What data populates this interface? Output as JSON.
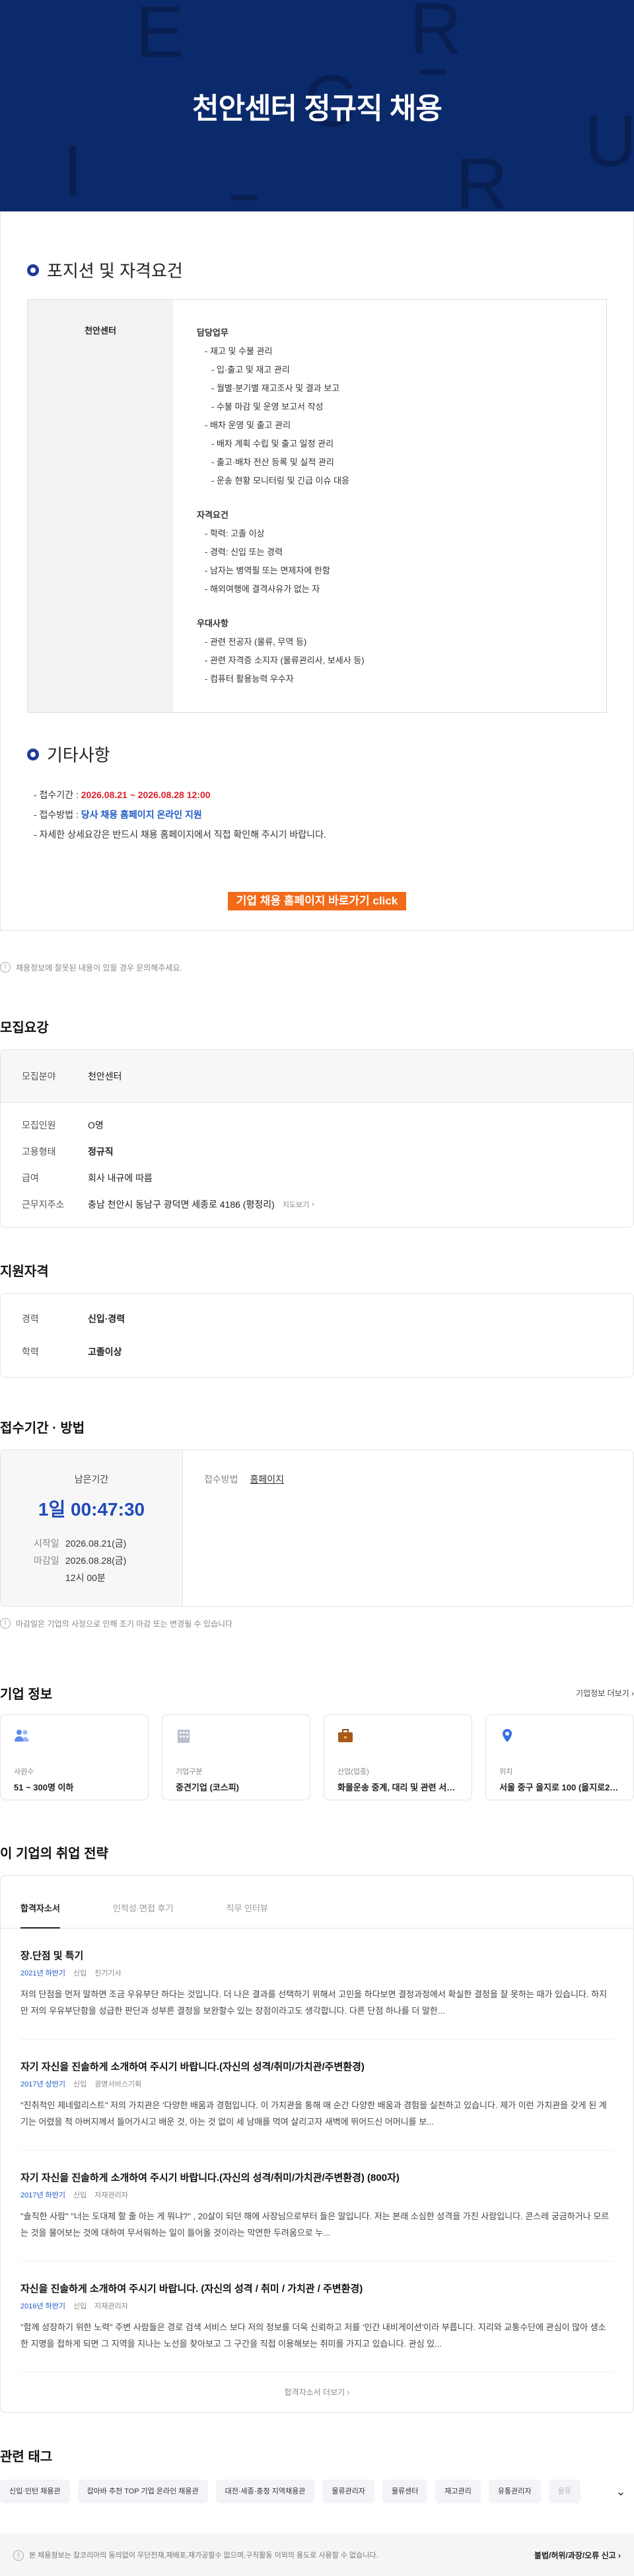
{
  "hero": {
    "title": "천안센터 정규직 채용",
    "letters": [
      "E",
      "R",
      "C",
      "U",
      "I",
      "R"
    ]
  },
  "position": {
    "heading": "포지션 및 자격요건",
    "team": "천안센터",
    "duty_title": "담당업무",
    "duties": [
      [
        "- 재고 및 수불 관리",
        1
      ],
      [
        "- 입·출고 및 재고 관리",
        2
      ],
      [
        "- 월별·분기별 재고조사 및 결과 보고",
        2
      ],
      [
        "- 수불 마감 및 운영 보고서 작성",
        2
      ],
      [
        "- 배차 운영 및 출고 관리",
        1
      ],
      [
        "- 배차 계획 수립 및 출고 일정 관리",
        2
      ],
      [
        "- 출고·배차 전산 등록 및 실적 관리",
        2
      ],
      [
        "- 운송 현황 모니터링 및 긴급 이슈 대응",
        2
      ]
    ],
    "req_title": "자격요건",
    "reqs": [
      "- 학력: 고졸 이상",
      "- 경력: 신입 또는 경력",
      "- 남자는 병역필 또는 면제자에 한함",
      "- 해외여행에 결격사유가 없는 자"
    ],
    "pref_title": "우대사항",
    "prefs": [
      "- 관련 전공자 (물류, 무역 등)",
      "- 관련 자격증 소지자 (물류관리사, 보세사 등)",
      "- 컴퓨터 활용능력 우수자"
    ]
  },
  "etc": {
    "heading": "기타사항",
    "period_label": "- 접수기간 : ",
    "period_value": "2026.08.21 ~ 2026.08.28 12:00",
    "method_label": "- 접수방법 : ",
    "method_value": "당사 채용 홈페이지 온라인 지원",
    "note": "- 자세한 상세요강은 반드시 채용 홈페이지에서 직접 확인해 주시기 바랍니다.",
    "button": "기업 채용 홈페이지 바로가기 click"
  },
  "notice": "채용정보에 잘못된 내용이 있을 경우 문의해주세요.",
  "summary": {
    "heading": "모집요강",
    "rows": [
      {
        "k": "모집분야",
        "v": "천안센터"
      },
      {
        "k": "모집인원",
        "v": "O명"
      },
      {
        "k": "고용형태",
        "v": "정규직"
      },
      {
        "k": "급여",
        "v": "회사 내규에 따름"
      },
      {
        "k": "근무지주소",
        "v": "충남 천안시 동남구 광덕면 세종로 4186 (평정리)"
      }
    ],
    "map_link": "지도보기"
  },
  "qualification": {
    "heading": "지원자격",
    "career_k": "경력",
    "career_v": "신입·경력",
    "edu_k": "학력",
    "edu_v": "고졸이상"
  },
  "apply": {
    "heading": "접수기간 · 방법",
    "remain_label": "남은기간",
    "remain_time": "1일 00:47:30",
    "start_k": "시작일",
    "start_v": "2026.08.21(금)",
    "end_k": "마감일",
    "end_v": "2026.08.28(금)",
    "end_time": "12시 00분",
    "method_k": "접수방법",
    "method_v": "홈페이지",
    "notice": "마감일은 기업의 사정으로 인해 조기 마감 또는 변경될 수 있습니다"
  },
  "company": {
    "heading": "기업 정보",
    "link": "기업정보 더보기",
    "cards": [
      {
        "k": "사원수",
        "v": "51 ~ 300명 이하",
        "icon": "people-icon"
      },
      {
        "k": "기업구분",
        "v": "중견기업 (코스피)",
        "icon": "building-icon"
      },
      {
        "k": "산업(업종)",
        "v": "화물운송 중계, 대리 및 관련 서비스업",
        "icon": "briefcase-icon"
      },
      {
        "k": "위치",
        "v": "서울 중구 을지로 100 (을지로2가)",
        "icon": "pin-icon"
      }
    ]
  },
  "strategy": {
    "heading": "이 기업의 취업 전략",
    "tabs": [
      "합격자소서",
      "인적성·면접 후기",
      "직무 인터뷰"
    ],
    "articles": [
      {
        "title": "장.단점 및 특기",
        "year": "2021년 하반기",
        "type": "신입",
        "job": "친기기사",
        "body": "저의 단점을 먼저 말하면 조금 우유부단 하다는 것입니다. 더 나은 결과를 선택하기 위해서 고민을 하다보면 결정과정에서 확실한 결정을 잘 못하는 때가 있습니다. 하지만 저의 우유부단함을 성급한 판단과 성부른 결정을 보완할수 있는 장점이라고도 생각합니다. 다른 단점 하나를 더 말한..."
      },
      {
        "title": "자기 자신을 진솔하게 소개하여 주시기 바랍니다.(자신의 성격/취미/가치관/주변환경)",
        "year": "2017년 상반기",
        "type": "신입",
        "job": "광명서비스기획",
        "body": "\"진취적인 제네럴리스트\" 저의 가치관은 '다양한 배움과 경험입니다. 이 가치관을 통해 매 순간 다양한 배움과 경험을 실천하고 있습니다. 제가 이런 가치관을 갖게 된 계기는 어렸을 적 아버지께서 들어가시고 배운 것, 아는 것 없이 세 남매를 먹여 살리고자 새벽에 뛰어드신 어머니를 보..."
      },
      {
        "title": "자기 자신을 진솔하게 소개하여 주시기 바랍니다.(자신의 성격/취미/가치관/주변환경) (800자)",
        "year": "2017년 하반기",
        "type": "신입",
        "job": "자재관리자",
        "body": "\"솔직한 사람\" \"너는 도대체 할 줄 아는 게 뭐냐?\" , 20살이 되던 해에 사장님으로부터 들은 말입니다. 저는 본래 소심한 성격을 가진 사람입니다. 콘스레 궁금하거나 모르는 것을 물어보는 것에 대하여 무서워하는 일이 들어올 것이라는 막연한 두려움으로 누..."
      },
      {
        "title": "자신을 진솔하게 소개하여 주시기 바랍니다. (자신의 성격 / 취미 / 가치관 / 주변환경)",
        "year": "2016년 하반기",
        "type": "신입",
        "job": "자재관리자",
        "body": "\"함께 성장하기 위한 노력\" 주변 사람들은 경로 검색 서비스 보다 저의 정보를 더욱 신뢰하고 저를 '인간 내비게이션'이라 부릅니다. 지리와 교통수단에 관심이 많아 생소한 지명을 접하게 되면 그 지역을 지나는 노선을 찾아보고 그 구간을 직접 이용해보는 취미를 가지고 있습니다. 관심 있..."
      }
    ],
    "more": "합격자소서 더보기"
  },
  "tags": {
    "heading": "관련 태그",
    "items": [
      "신입·인턴 채용관",
      "잡아바 추천 TOP 기업 온라인 채용관",
      "대전·세종·충청 지역채용관",
      "물류관리자",
      "물류센터",
      "재고관리",
      "유통관리자",
      "물류"
    ]
  },
  "footer": {
    "notice": "본 채용정보는 잡코리아의 동의없이 무단전재,재배포,재가공할수 없으며,구직활동 이외의 용도로 사용할 수 없습니다.",
    "report": "불법/허위/과장/오류 신고"
  },
  "colors": {
    "hero": "#0b2a6b",
    "accent": "#1f3a9a",
    "orange": "#f36a19",
    "red": "#e0202a",
    "link": "#1f59c7"
  }
}
